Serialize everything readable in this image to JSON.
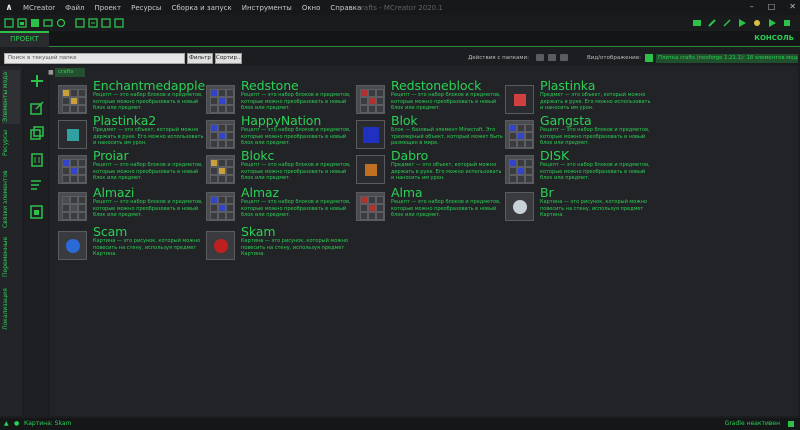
{
  "window": {
    "title": "crafts - MCreator 2020.1"
  },
  "menu": [
    "MCreator",
    "Файл",
    "Проект",
    "Ресурсы",
    "Сборка и запуск",
    "Инструменты",
    "Окно",
    "Справка"
  ],
  "tabs": {
    "project": "ПРОЕКТ",
    "console": "КОНСОЛЬ"
  },
  "filter": {
    "search_placeholder": "Поиск в текущей папке",
    "filter_label": "Фильтр",
    "sort_label": "Сортир...",
    "actions_label": "Действия с папками:",
    "view_label": "Вид/отображение:",
    "workspace_info": "Плитка   crafts (neoforge 1.21.1): 18 элементов мода"
  },
  "breadcrumb": "crafts",
  "left_tabs": [
    "Элементы мода",
    "Ресурсы",
    "Связки элементов",
    "Переменные",
    "Локализация"
  ],
  "elements": [
    {
      "name": "Enchantmedapple",
      "desc": "Рецепт — это набор блоков и предметов, которые можно преобразовать в новый блок или предмет.",
      "kind": "grid",
      "icon_color": "#c9a03a"
    },
    {
      "name": "Redstone",
      "desc": "Рецепт — это набор блоков и предметов, которые можно преобразовать в новый блок или предмет.",
      "kind": "grid",
      "icon_color": "#3344cc"
    },
    {
      "name": "Redstoneblock",
      "desc": "Рецепт — это набор блоков и предметов, которые можно преобразовать в новый блок или предмет.",
      "kind": "grid",
      "icon_color": "#b03030"
    },
    {
      "name": "Plastinka",
      "desc": "Предмет — это объект, который можно держать в руке. Его можно использовать и наносить им урон.",
      "kind": "item",
      "icon_color": "#d04040"
    },
    {
      "name": "Plastinka2",
      "desc": "Предмет — это объект, который можно держать в руке. Его можно использовать и наносить им урон.",
      "kind": "item",
      "icon_color": "#30a0a0"
    },
    {
      "name": "HappyNation",
      "desc": "Рецепт — это набор блоков и предметов, которые можно преобразовать в новый блок или предмет.",
      "kind": "grid",
      "icon_color": "#3344cc"
    },
    {
      "name": "Blok",
      "desc": "Блок — базовый элемент Minecraft. Это трехмерный объект, который может быть размещен в мире.",
      "kind": "block",
      "icon_color": "#2030c0"
    },
    {
      "name": "Gangsta",
      "desc": "Рецепт — это набор блоков и предметов, которые можно преобразовать в новый блок или предмет.",
      "kind": "grid",
      "icon_color": "#3344cc"
    },
    {
      "name": "Proiar",
      "desc": "Рецепт — это набор блоков и предметов, которые можно преобразовать в новый блок или предмет.",
      "kind": "grid",
      "icon_color": "#3344cc"
    },
    {
      "name": "Blokc",
      "desc": "Рецепт — это набор блоков и предметов, которые можно преобразовать в новый блок или предмет.",
      "kind": "grid",
      "icon_color": "#c9a03a"
    },
    {
      "name": "Dabro",
      "desc": "Предмет — это объект, который можно держать в руке. Его можно использовать и наносить им урон.",
      "kind": "item",
      "icon_color": "#c07020"
    },
    {
      "name": "DISK",
      "desc": "Рецепт — это набор блоков и предметов, которые можно преобразовать в новый блок или предмет.",
      "kind": "grid",
      "icon_color": "#3344cc"
    },
    {
      "name": "Almazi",
      "desc": "Рецепт — это набор блоков и предметов, которые можно преобразовать в новый блок или предмет.",
      "kind": "grid",
      "icon_color": "#4a4b4f"
    },
    {
      "name": "Almaz",
      "desc": "Рецепт — это набор блоков и предметов, которые можно преобразовать в новый блок или предмет.",
      "kind": "grid",
      "icon_color": "#3344cc"
    },
    {
      "name": "Alma",
      "desc": "Рецепт — это набор блоков и предметов, которые можно преобразовать в новый блок или предмет.",
      "kind": "grid",
      "icon_color": "#b03030"
    },
    {
      "name": "Br",
      "desc": "Картина — это рисунок, который можно повесить на стену, используя предмет Картина.",
      "kind": "picture",
      "icon_color": "#c8d0d8"
    },
    {
      "name": "Scam",
      "desc": "Картина — это рисунок, который можно повесить на стену, используя предмет Картина.",
      "kind": "picture",
      "icon_color": "#2a6ad8"
    },
    {
      "name": "Skam",
      "desc": "Картина — это рисунок, который можно повесить на стену, используя предмет Картина.",
      "kind": "picture",
      "icon_color": "#c02020"
    }
  ],
  "status": {
    "left": "Картина: Skam",
    "right": "Gradle неактивен"
  },
  "colors": {
    "accent": "#2bd155",
    "background": "#222326"
  }
}
